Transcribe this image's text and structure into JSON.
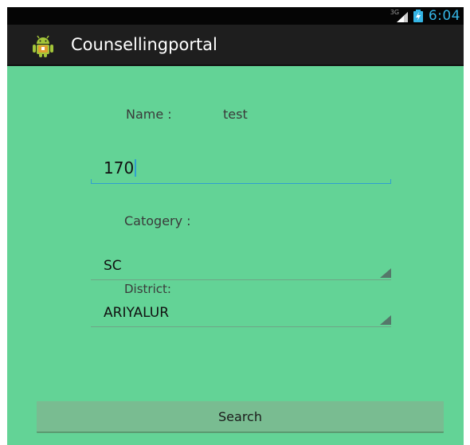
{
  "status_bar": {
    "network_type": "3G",
    "time": "6:04",
    "icons": [
      "signal-icon",
      "battery-charging-icon"
    ]
  },
  "action_bar": {
    "app_icon": "android-robot-icon",
    "title": "Counsellingportal"
  },
  "form": {
    "name_label": "Name :",
    "name_value": "test",
    "number_input_value": "170",
    "category_label": "Catogery :",
    "category_selected": "SC",
    "district_label": "District:",
    "district_selected": "ARIYALUR",
    "search_label": "Search"
  },
  "colors": {
    "background": "#63d396",
    "accent": "#35b5e5",
    "action_bar": "#1e1e1e",
    "button": "#79bc91"
  }
}
